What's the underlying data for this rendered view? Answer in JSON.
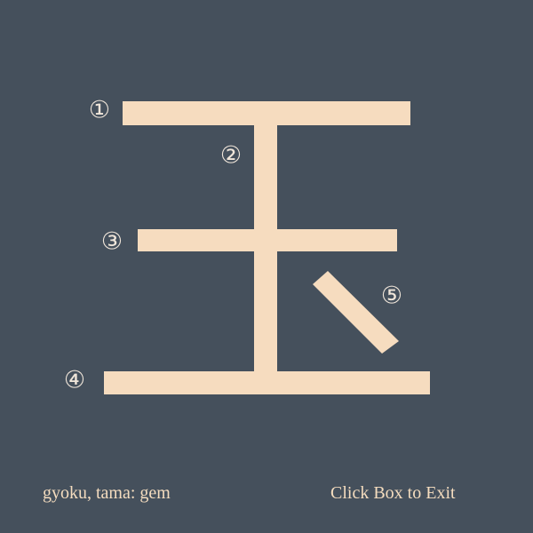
{
  "kanji": {
    "stroke_color": "#f6dcbf",
    "number_color": "#f0e6da",
    "background": "#45505c",
    "strokes": [
      {
        "number": "①",
        "name": "stroke-1"
      },
      {
        "number": "②",
        "name": "stroke-2"
      },
      {
        "number": "③",
        "name": "stroke-3"
      },
      {
        "number": "④",
        "name": "stroke-4"
      },
      {
        "number": "⑤",
        "name": "stroke-5"
      }
    ]
  },
  "footer": {
    "meaning": "gyoku, tama: gem",
    "exit_label": "Click Box to Exit"
  }
}
